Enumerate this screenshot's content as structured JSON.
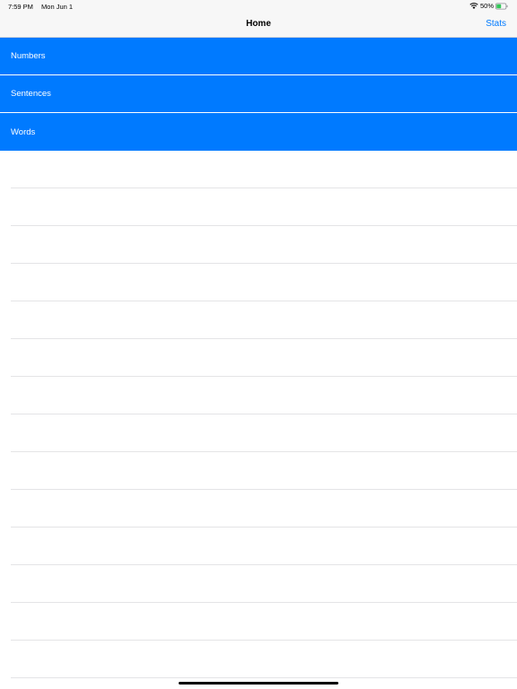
{
  "status_bar": {
    "time": "7:59 PM",
    "date": "Mon Jun 1",
    "battery_percent": "50%",
    "icons": [
      "wifi-icon",
      "battery-icon"
    ]
  },
  "nav": {
    "title": "Home",
    "right_action": "Stats"
  },
  "menu": {
    "items": [
      {
        "label": "Numbers"
      },
      {
        "label": "Sentences"
      },
      {
        "label": "Words"
      }
    ]
  },
  "colors": {
    "accent": "#007aff",
    "row_text": "#ffffff",
    "bar_background": "#f7f7f7",
    "separator": "#e4e4e6"
  }
}
